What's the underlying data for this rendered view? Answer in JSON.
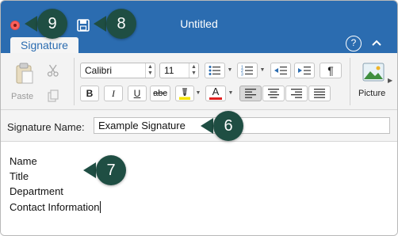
{
  "window": {
    "title": "Untitled"
  },
  "ribbon": {
    "tab_label": "Signature",
    "paste_label": "Paste",
    "font_name": "Calibri",
    "font_size": "11",
    "picture_label": "Picture",
    "bold": "B",
    "italic": "I",
    "underline": "U",
    "strikethrough": "abc",
    "highlight_letter": "",
    "font_color_letter": "A",
    "paragraph_mark": "¶",
    "help": "?"
  },
  "signature_name": {
    "label": "Signature Name:",
    "value": "Example Signature"
  },
  "signature_body": [
    "Name",
    "Title",
    "Department",
    "Contact Information"
  ],
  "callouts": {
    "c9": "9",
    "c8": "8",
    "c6": "6",
    "c7": "7"
  },
  "colors": {
    "title_bar": "#2b6cb0",
    "callout": "#1f4e43",
    "highlight": "#f5e400",
    "font_color": "#e02020",
    "close_button": "#fc605c"
  }
}
